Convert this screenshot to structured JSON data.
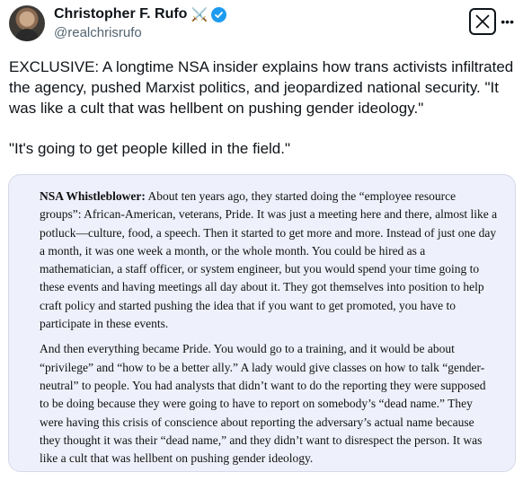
{
  "author": {
    "display_name": "Christopher F. Rufo",
    "emoji_icon": "crossed-swords-icon",
    "verified": true,
    "handle": "@realchrisrufo"
  },
  "app": {
    "logo_icon": "x-logo-icon",
    "more_icon": "more-options-icon"
  },
  "tweet": {
    "paragraphs": [
      "EXCLUSIVE: A longtime NSA insider explains how trans activists infiltrated the agency, pushed Marxist politics, and jeopardized national security. \"It was like a cult that was hellbent on pushing gender ideology.\"",
      "\"It's going to get people killed in the field.\""
    ]
  },
  "quote_image": {
    "speaker_label": "NSA Whistleblower:",
    "paragraph1_rest": " About ten years ago, they started doing the “employee resource groups”: African-American, veterans, Pride. It was just a meeting here and there, almost like a potluck—culture, food, a speech. Then it started to get more and more. Instead of just one day a month, it was one week a month, or the whole month. You could be hired as a mathematician, a staff officer, or system engineer, but you would spend your time going to these events and having meetings all day about it. They got themselves into position to help craft policy and started pushing the idea that if you want to get promoted, you have to participate in these events.",
    "paragraph2": "And then everything became Pride. You would go to a training, and it would be about “privilege” and “how to be a better ally.” A lady would give classes on how to talk “gender-neutral” to people. You had analysts that didn’t want to do the reporting they were supposed to be doing because they were going to have to report on somebody’s “dead name.” They were having this crisis of conscience about reporting the adversary’s actual name because they thought it was their “dead name,” and they didn’t want to disrespect the person. It was like a cult that was hellbent on pushing gender ideology."
  },
  "colors": {
    "text": "#0f1419",
    "secondary_text": "#536471",
    "verified_blue": "#1d9bf0",
    "quote_background": "#eef0fb"
  }
}
